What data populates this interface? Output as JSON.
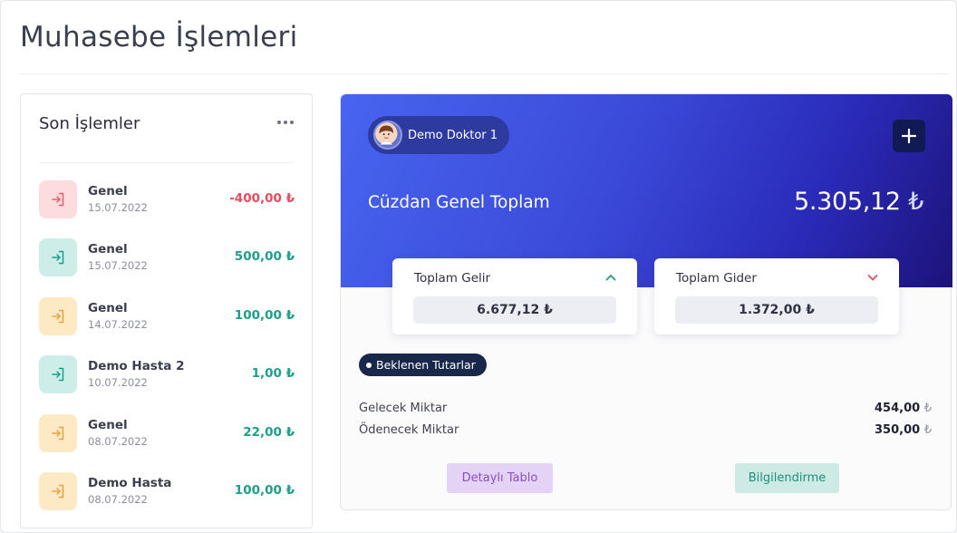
{
  "page": {
    "title": "Muhasebe İşlemleri"
  },
  "recent": {
    "title": "Son İşlemler",
    "menu_icon": "more-horizontal-icon",
    "transactions": [
      {
        "name": "Genel",
        "date": "15.07.2022",
        "amount": "-400,00 ₺",
        "kind": "expense",
        "icon": "sign-in-icon"
      },
      {
        "name": "Genel",
        "date": "15.07.2022",
        "amount": "500,00 ₺",
        "kind": "income",
        "icon": "sign-in-icon"
      },
      {
        "name": "Genel",
        "date": "14.07.2022",
        "amount": "100,00 ₺",
        "kind": "pending",
        "icon": "sign-in-icon"
      },
      {
        "name": "Demo Hasta 2",
        "date": "10.07.2022",
        "amount": "1,00 ₺",
        "kind": "income",
        "icon": "sign-in-icon"
      },
      {
        "name": "Genel",
        "date": "08.07.2022",
        "amount": "22,00 ₺",
        "kind": "pending",
        "icon": "sign-in-icon"
      },
      {
        "name": "Demo Hasta",
        "date": "08.07.2022",
        "amount": "100,00 ₺",
        "kind": "pending",
        "icon": "sign-in-icon"
      }
    ]
  },
  "wallet": {
    "doctor_name": "Demo Doktor 1",
    "label": "Cüzdan Genel Toplam",
    "total": "5.305,12",
    "currency": "₺",
    "add_icon": "plus-icon",
    "income": {
      "title": "Toplam Gelir",
      "value": "6.677,12 ₺",
      "icon": "chevron-up-icon"
    },
    "expense": {
      "title": "Toplam Gider",
      "value": "1.372,00 ₺",
      "icon": "chevron-down-icon"
    },
    "pending_badge": "Beklenen Tutarlar",
    "future_label": "Gelecek Miktar",
    "future_value": "454,00",
    "payable_label": "Ödenecek Miktar",
    "payable_value": "350,00",
    "detail_button": "Detaylı Tablo",
    "info_button": "Bilgilendirme"
  },
  "colors": {
    "expense": "#e04f5f",
    "income": "#1f9e87",
    "expense_bg": "#fcdcdf",
    "income_bg": "#cdeee8",
    "pending_bg": "#fde9c4",
    "pending_icon": "#e3a543",
    "income_icon": "#1f9e87",
    "expense_icon": "#e0606e"
  }
}
